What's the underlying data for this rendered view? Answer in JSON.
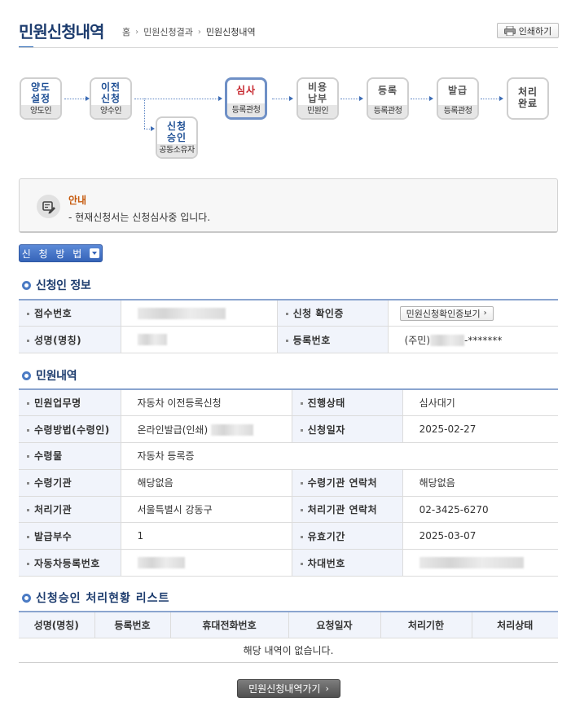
{
  "header": {
    "title": "민원신청내역",
    "breadcrumb": [
      "홈",
      "민원신청결과",
      "민원신청내역"
    ],
    "print_label": "인쇄하기"
  },
  "process": {
    "steps": [
      {
        "label": "양도\n설정",
        "sub": "양도인"
      },
      {
        "label": "이전\n신청",
        "sub": "양수인"
      },
      {
        "label": "신청\n승인",
        "sub": "공동소유자"
      },
      {
        "label": "심사",
        "sub": "등록관청"
      },
      {
        "label": "비용\n납부",
        "sub": "민원인"
      },
      {
        "label": "등록",
        "sub": "등록관청"
      },
      {
        "label": "발급",
        "sub": "등록관청"
      },
      {
        "label": "처리\n완료",
        "sub": ""
      }
    ],
    "active_step": "심사"
  },
  "notice": {
    "title": "안내",
    "text": "- 현재신청서는 신청심사중 입니다."
  },
  "method_button": "신 청 방 법",
  "applicant": {
    "section_title": "신청인 정보",
    "receipt_no_label": "접수번호",
    "confirm_label": "신청 확인증",
    "confirm_button": "민원신청확인증보기",
    "name_label": "성명(명칭)",
    "reg_no_label": "등록번호",
    "reg_no_prefix": "(주민)",
    "reg_no_masked": "-*******"
  },
  "petition": {
    "section_title": "민원내역",
    "rows": [
      {
        "l1": "민원업무명",
        "v1": "자동차 이전등록신청",
        "l2": "진행상태",
        "v2": "심사대기"
      },
      {
        "l1": "수령방법(수령인)",
        "v1": "온라인발급(인쇄)",
        "l2": "신청일자",
        "v2": "2025-02-27"
      },
      {
        "l1": "수령물",
        "v1": "자동차 등록증"
      },
      {
        "l1": "수령기관",
        "v1": "해당없음",
        "l2": "수령기관 연락처",
        "v2": "해당없음"
      },
      {
        "l1": "처리기관",
        "v1": "서울특별시 강동구",
        "l2": "처리기관 연락처",
        "v2": "02-3425-6270"
      },
      {
        "l1": "발급부수",
        "v1": "1",
        "l2": "유효기간",
        "v2": "2025-03-07"
      },
      {
        "l1": "자동차등록번호",
        "v1": "",
        "l2": "차대번호",
        "v2": ""
      }
    ]
  },
  "approval_list": {
    "section_title": "신청승인 처리현황 리스트",
    "columns": [
      "성명(명칭)",
      "등록번호",
      "휴대전화번호",
      "요청일자",
      "처리기한",
      "처리상태"
    ],
    "empty_text": "해당 내역이 없습니다."
  },
  "go_button": "민원신청내역가기"
}
